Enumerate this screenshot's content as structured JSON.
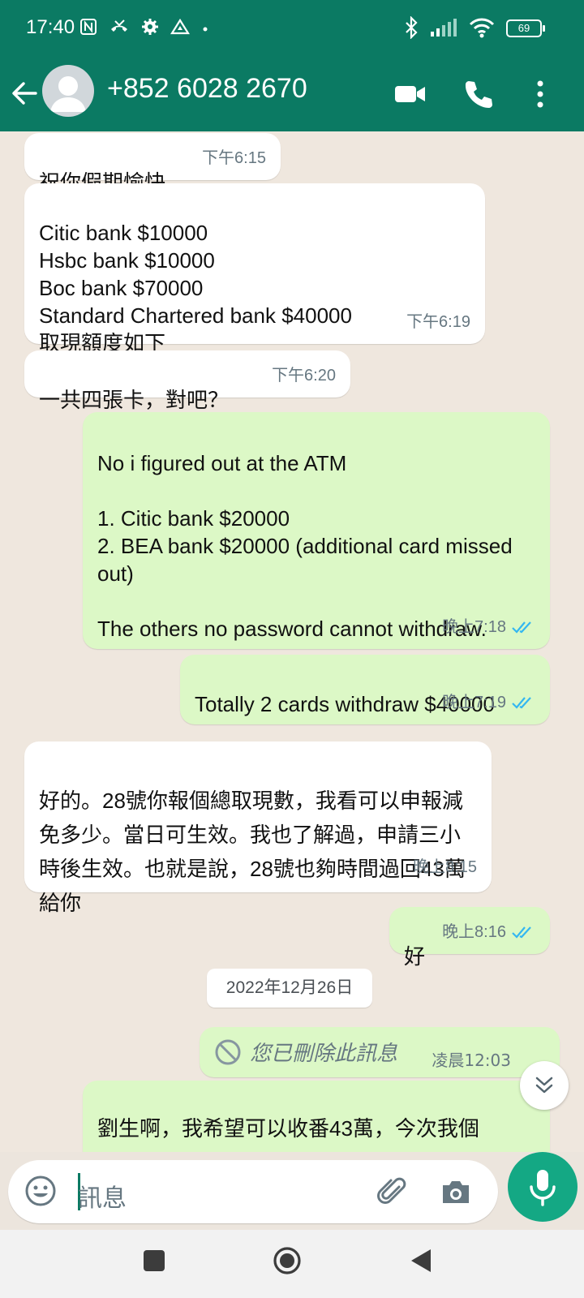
{
  "status_bar": {
    "time": "17:40",
    "battery": "69"
  },
  "header": {
    "contact_name": "+852 6028 2670"
  },
  "messages": [
    {
      "dir": "in",
      "text": "祝你假期愉快",
      "time": "下午6:15"
    },
    {
      "dir": "in",
      "text": "Citic bank $10000\nHsbc bank $10000\nBoc bank $70000\nStandard Chartered bank $40000\n取現額度如下",
      "time": "下午6:19"
    },
    {
      "dir": "in",
      "text": "一共四張卡，對吧？",
      "time": "下午6:20"
    },
    {
      "dir": "out",
      "text": "No i figured out at the ATM\n\n1. Citic bank $20000\n2. BEA bank $20000 (additional card missed out)\n\nThe others no password cannot withdraw.",
      "time": "晚上7:18"
    },
    {
      "dir": "out",
      "text": "Totally 2 cards withdraw $40000",
      "time": "晚上7:19"
    },
    {
      "dir": "in",
      "text": "好的。28號你報個總取現數，我看可以申報減免多少。當日可生效。我也了解過，申請三小時後生效。也就是說，28號也夠時間過回43萬給你",
      "time": "晚上8:15"
    },
    {
      "dir": "out",
      "text": "好",
      "time": "晚上8:16"
    }
  ],
  "date_divider": "2022年12月26日",
  "deleted_message": {
    "text": "您已刪除此訊息",
    "time": "凌晨12:03"
  },
  "last_message_partial": "劉生啊，我希望可以收番43萬，今次我個",
  "input": {
    "placeholder": "訊息"
  },
  "colors": {
    "header": "#0b7a63",
    "outgoing": "#dcf8c6",
    "incoming": "#ffffff",
    "accent": "#14a884",
    "read_ticks": "#34b7f1"
  },
  "icons": [
    "back-arrow-icon",
    "video-call-icon",
    "phone-icon",
    "more-vert-icon",
    "emoji-icon",
    "attach-icon",
    "camera-icon",
    "mic-icon",
    "scroll-down-icon",
    "deleted-icon"
  ]
}
